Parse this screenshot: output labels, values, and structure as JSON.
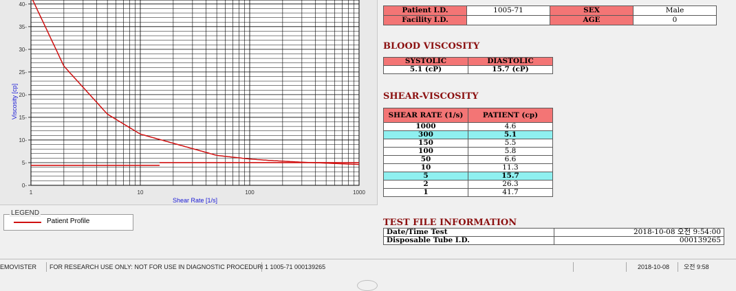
{
  "chart_data": {
    "type": "line",
    "x_scale": "log",
    "xlim": [
      1,
      1000
    ],
    "ylim": [
      0,
      43
    ],
    "xlabel": "Shear Rate [1/s]",
    "ylabel": "Viscosity [cp]",
    "x_ticks": [
      "1",
      "10",
      "100",
      "1000"
    ],
    "y_ticks": [
      0,
      5,
      10,
      15,
      20,
      25,
      30,
      35,
      40
    ],
    "grid": true,
    "series": [
      {
        "name": "Patient Profile",
        "color": "#d01010",
        "x": [
          1,
          2,
          5,
          10,
          50,
          100,
          150,
          300,
          1000
        ],
        "y": [
          41.7,
          26.3,
          15.7,
          11.3,
          6.6,
          5.8,
          5.5,
          5.1,
          4.6
        ]
      }
    ],
    "ref_line_y": 4.4
  },
  "legend": {
    "title": "LEGEND",
    "items": [
      {
        "label": "Patient Profile",
        "color": "#d01010"
      }
    ]
  },
  "patient": {
    "id_label": "Patient I.D.",
    "id_value": "1005-71",
    "sex_label": "SEX",
    "sex_value": "Male",
    "facility_label": "Facility I.D.",
    "facility_value": "",
    "age_label": "AGE",
    "age_value": "0"
  },
  "blood_viscosity": {
    "title": "BLOOD VISCOSITY",
    "systolic_label": "SYSTOLIC",
    "systolic_value": "5.1 (cP)",
    "diastolic_label": "DIASTOLIC",
    "diastolic_value": "15.7 (cP)"
  },
  "shear_viscosity": {
    "title": "SHEAR-VISCOSITY",
    "col_shear": "SHEAR RATE (1/s)",
    "col_patient": "PATIENT (cp)",
    "rows": [
      {
        "rate": "1000",
        "value": "4.6",
        "highlight": false
      },
      {
        "rate": "300",
        "value": "5.1",
        "highlight": true
      },
      {
        "rate": "150",
        "value": "5.5",
        "highlight": false
      },
      {
        "rate": "100",
        "value": "5.8",
        "highlight": false
      },
      {
        "rate": "50",
        "value": "6.6",
        "highlight": false
      },
      {
        "rate": "10",
        "value": "11.3",
        "highlight": false
      },
      {
        "rate": "5",
        "value": "15.7",
        "highlight": true
      },
      {
        "rate": "2",
        "value": "26.3",
        "highlight": false
      },
      {
        "rate": "1",
        "value": "41.7",
        "highlight": false
      }
    ]
  },
  "test_file": {
    "title": "TEST FILE INFORMATION",
    "date_label": "Date/Time Test",
    "date_value": "2018-10-08  오전 9:54:00",
    "tube_label": "Disposable Tube I.D.",
    "tube_value": "000139265"
  },
  "statusbar": {
    "app": "EMOVISTER",
    "notice": "FOR RESEARCH USE ONLY: NOT FOR USE IN DIAGNOSTIC PROCEDURES",
    "record": "1  1005-71  000139265",
    "empty": "",
    "date": "2018-10-08",
    "time": "오전 9:58"
  }
}
